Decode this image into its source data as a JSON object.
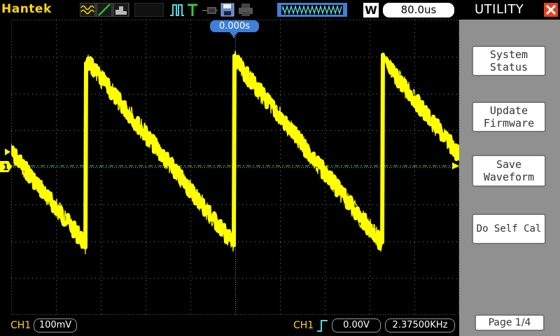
{
  "header": {
    "brand": "Hantek",
    "icons": [
      "waveform-mode-icon",
      "line-mode-icon",
      "persist-icon",
      "run-pulse-icon",
      "trigger-T-icon",
      "probe-icon",
      "save-disk-icon",
      "print-icon",
      "memory-depth-icon"
    ],
    "window_mode": "W",
    "timebase": "80.0us"
  },
  "screen": {
    "trigger_position": "0.000s",
    "channel_marker": "1"
  },
  "footer": {
    "ch1_label": "CH1",
    "ch1_scale": "100mV",
    "trigger_source": "CH1",
    "trigger_level": "0.00V",
    "frequency": "2.37500KHz"
  },
  "menu": {
    "title": "UTILITY",
    "buttons": [
      {
        "label": "System\nStatus"
      },
      {
        "label": "Update\nFirmware"
      },
      {
        "label": "Save\nWaveform"
      },
      {
        "label": "Do Self Cal"
      }
    ],
    "page": "Page 1/4"
  },
  "colors": {
    "trace": "#ffff00",
    "accent_yellow": "#ffd800",
    "trigger_blue": "#3e7fd9",
    "ground_green": "#30c030",
    "menu_bg": "#909090",
    "close_red": "#e8431d"
  }
}
